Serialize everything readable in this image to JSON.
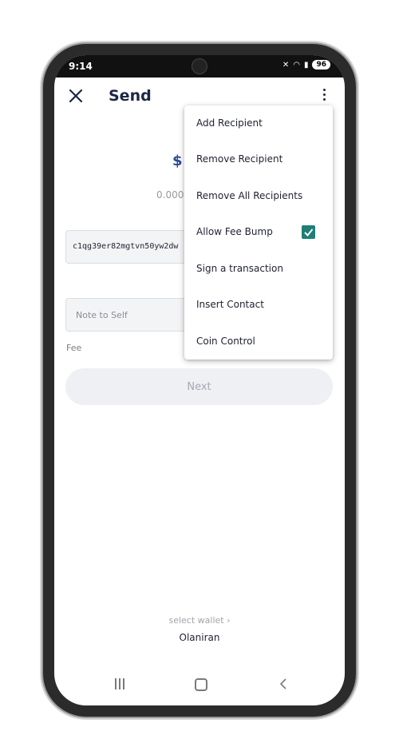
{
  "status_bar": {
    "time": "9:14",
    "battery": "96"
  },
  "app_bar": {
    "title": "Send",
    "close_icon": "close-icon",
    "more_icon": "more-vertical-icon"
  },
  "amount": {
    "currency_symbol": "$",
    "fiat_value": "0.0001"
  },
  "recipient": {
    "address": "c1qg39er82mgtvn50yw2dw"
  },
  "note": {
    "placeholder": "Note to Self"
  },
  "fee": {
    "label": "Fee"
  },
  "next_button": {
    "label": "Next"
  },
  "wallet_selector": {
    "label": "select wallet",
    "wallet_name": "Olaniran"
  },
  "menu": {
    "items": [
      {
        "label": "Add Recipient"
      },
      {
        "label": "Remove Recipient"
      },
      {
        "label": "Remove All Recipients"
      },
      {
        "label": "Allow Fee Bump",
        "checked": true
      },
      {
        "label": "Sign a transaction"
      },
      {
        "label": "Insert Contact"
      },
      {
        "label": "Coin Control"
      }
    ]
  },
  "colors": {
    "accent": "#1f7e78",
    "title": "#1d2744"
  }
}
